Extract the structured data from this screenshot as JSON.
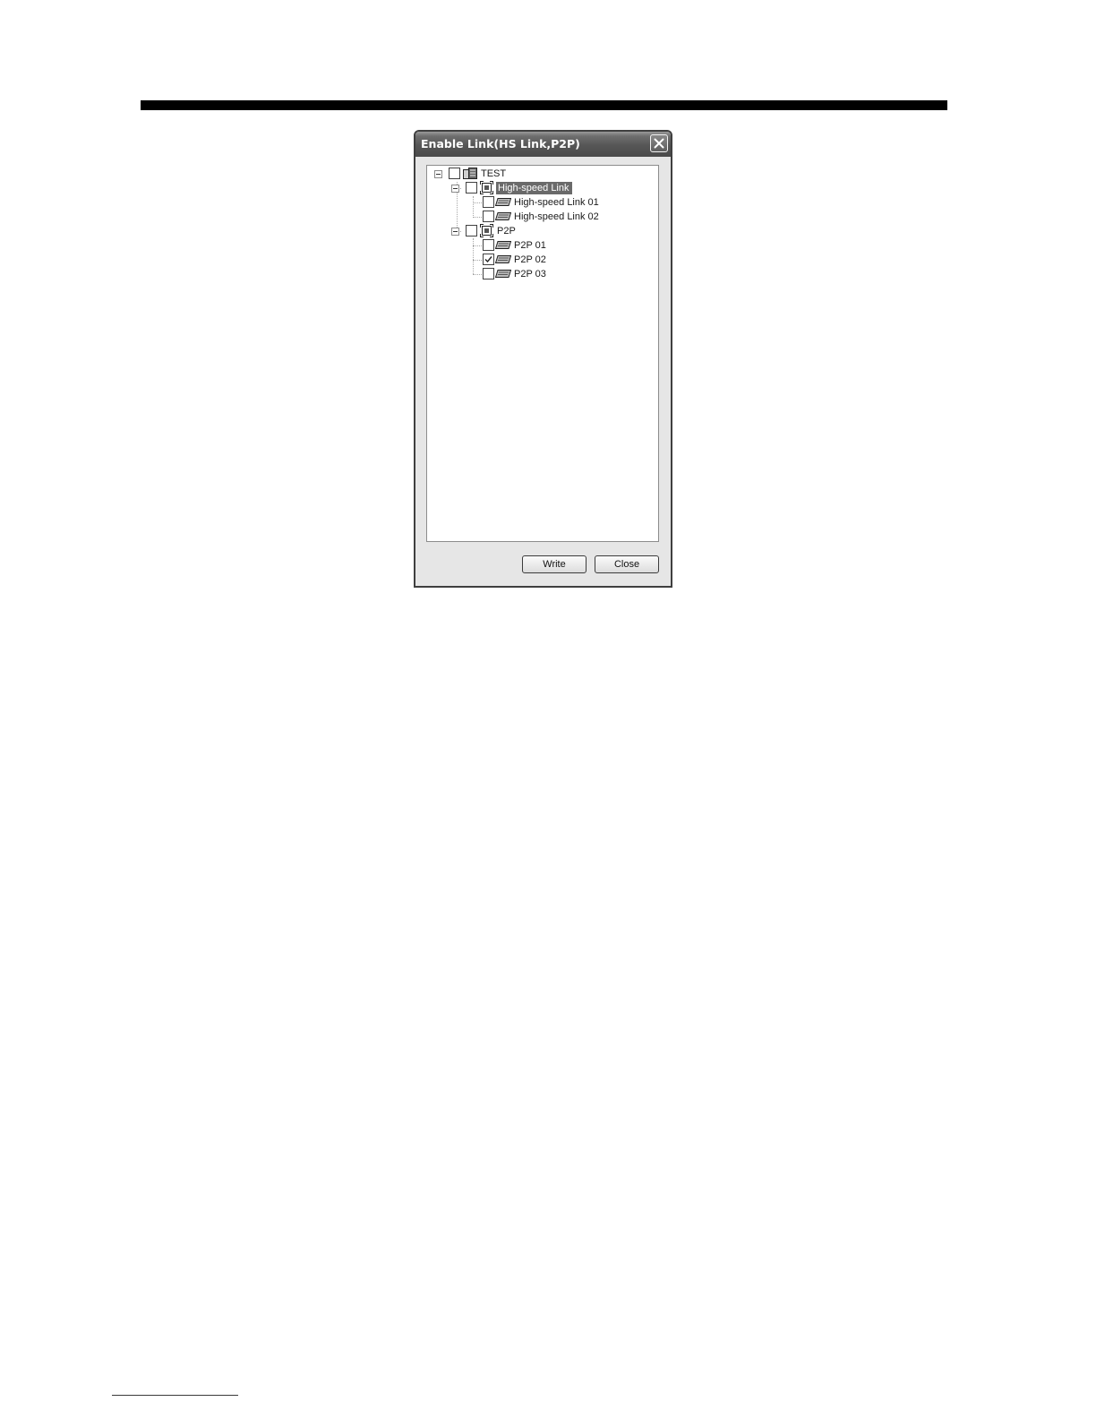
{
  "dialog": {
    "title": "Enable Link(HS Link,P2P)",
    "close_icon": "close-icon",
    "tree": {
      "root": {
        "label": "TEST",
        "icon": "plc-project-icon",
        "checked": false,
        "expanded": true
      },
      "groups": [
        {
          "label": "High-speed Link",
          "icon": "network-group-icon",
          "checked": false,
          "expanded": true,
          "selected": true,
          "items": [
            {
              "label": "High-speed Link 01",
              "icon": "link-item-icon",
              "checked": false
            },
            {
              "label": "High-speed Link 02",
              "icon": "link-item-icon",
              "checked": false
            }
          ]
        },
        {
          "label": "P2P",
          "icon": "network-group-icon",
          "checked": false,
          "expanded": true,
          "selected": false,
          "items": [
            {
              "label": "P2P 01",
              "icon": "link-item-icon",
              "checked": false
            },
            {
              "label": "P2P 02",
              "icon": "link-item-icon",
              "checked": true
            },
            {
              "label": "P2P 03",
              "icon": "link-item-icon",
              "checked": false
            }
          ]
        }
      ]
    },
    "buttons": {
      "write_label": "Write",
      "close_label": "Close"
    }
  }
}
